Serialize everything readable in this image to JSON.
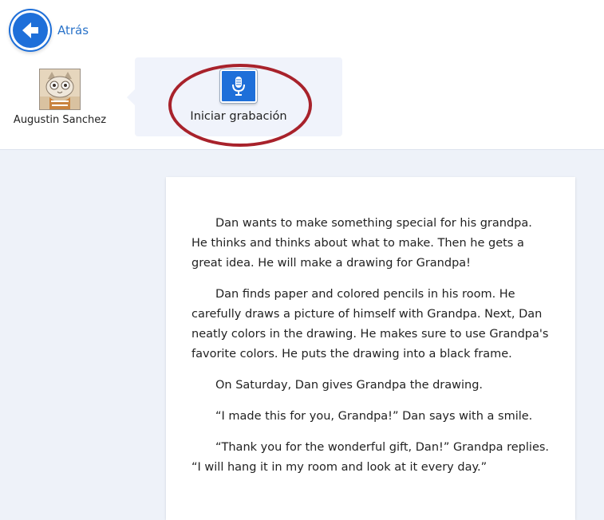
{
  "nav": {
    "back_label": "Atrás"
  },
  "student": {
    "name": "Augustin Sanchez"
  },
  "recorder": {
    "label": "Iniciar grabación"
  },
  "passage": {
    "paragraphs": [
      "Dan wants to make something special for his grandpa. He thinks and thinks about what to make. Then he gets a great idea. He will make a drawing for Grandpa!",
      "Dan finds paper and colored pencils in his room. He carefully draws a picture of himself with Grandpa. Next, Dan neatly colors in the drawing. He makes sure to use Grandpa's favorite colors. He puts the drawing into a black frame.",
      "On Saturday, Dan gives Grandpa the drawing.",
      "“I made this for you, Grandpa!” Dan says with a smile.",
      "“Thank you for the wonderful gift, Dan!” Grandpa replies. “I will hang it in my room and look at it every day.”"
    ]
  },
  "colors": {
    "accent": "#1e6fd9",
    "highlight_ring": "#a8222b",
    "background": "#eef2f9",
    "panel": "#f0f3fb"
  },
  "icons": {
    "back": "arrow-left-icon",
    "record": "microphone-icon",
    "avatar": "cat-avatar-icon"
  }
}
